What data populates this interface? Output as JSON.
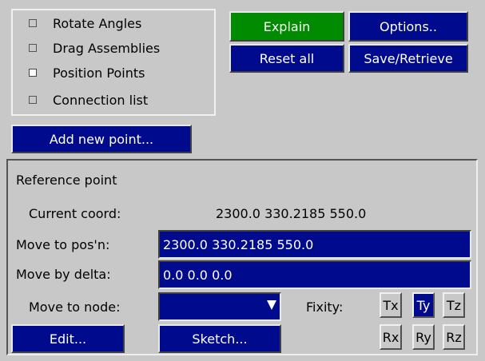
{
  "checkboxes": [
    {
      "label": "Rotate Angles",
      "checked": false
    },
    {
      "label": "Drag Assemblies",
      "checked": false
    },
    {
      "label": "Position Points",
      "checked": true
    },
    {
      "label": "Connection list",
      "checked": false
    }
  ],
  "buttons": {
    "explain": "Explain",
    "options": "Options..",
    "reset_all": "Reset all",
    "save_retrieve": "Save/Retrieve",
    "add_new_point": "Add new point...",
    "edit": "Edit...",
    "sketch": "Sketch..."
  },
  "reference": {
    "title": "Reference point",
    "current_coord_label": "Current coord:",
    "current_coord_value": "2300.0  330.2185  550.0",
    "move_to_pos_label": "Move to pos'n:",
    "move_to_pos_value": "2300.0  330.2185  550.0",
    "move_by_delta_label": "Move by delta:",
    "move_by_delta_value": "0.0  0.0  0.0",
    "move_to_node_label": "Move to node:",
    "move_to_node_value": "",
    "fixity_label": "Fixity:"
  },
  "fixity": [
    {
      "label": "Tx",
      "active": false
    },
    {
      "label": "Ty",
      "active": true
    },
    {
      "label": "Tz",
      "active": false
    },
    {
      "label": "Rx",
      "active": false
    },
    {
      "label": "Ry",
      "active": false
    },
    {
      "label": "Rz",
      "active": false
    }
  ],
  "colors": {
    "button_blue": "#000a8c",
    "button_green": "#008b00",
    "background": "#c8c8c8"
  }
}
